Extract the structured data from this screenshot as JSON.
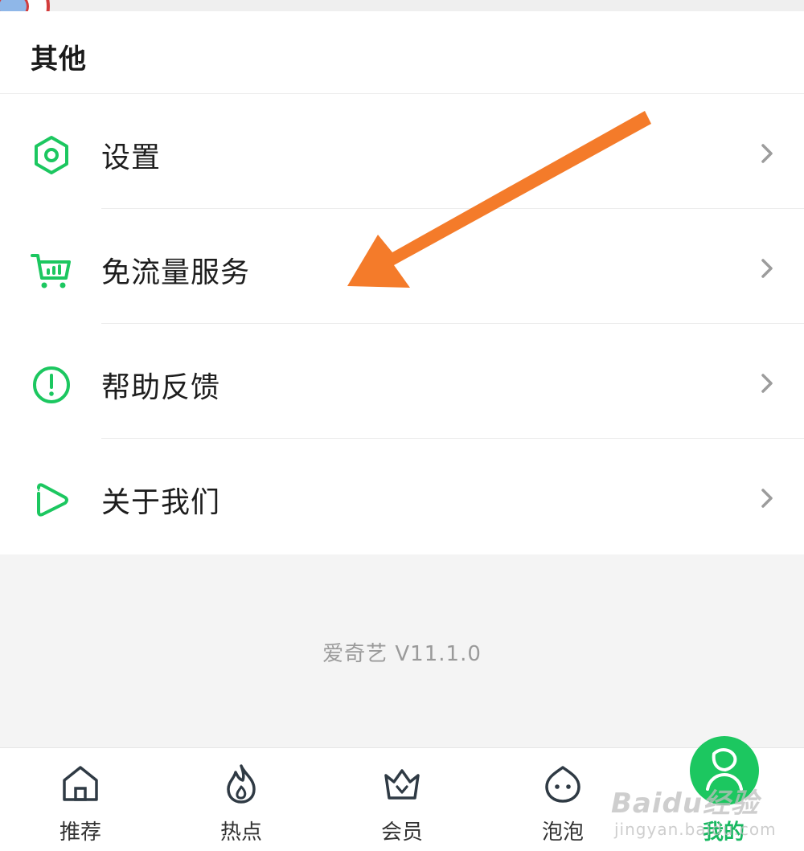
{
  "section": {
    "title": "其他"
  },
  "menu": [
    {
      "label": "设置",
      "icon": "settings-hexagon-icon"
    },
    {
      "label": "免流量服务",
      "icon": "cart-icon"
    },
    {
      "label": "帮助反馈",
      "icon": "help-exclamation-icon"
    },
    {
      "label": "关于我们",
      "icon": "play-about-icon"
    }
  ],
  "version": "爱奇艺 V11.1.0",
  "tabbar": [
    {
      "label": "推荐",
      "icon": "home-icon",
      "active": false
    },
    {
      "label": "热点",
      "icon": "flame-icon",
      "active": false
    },
    {
      "label": "会员",
      "icon": "crown-icon",
      "active": false
    },
    {
      "label": "泡泡",
      "icon": "bubble-face-icon",
      "active": false
    },
    {
      "label": "我的",
      "icon": "profile-icon",
      "active": true
    }
  ],
  "watermark": {
    "brand": "Baidu经验",
    "url": "jingyan.baidu.com"
  },
  "colors": {
    "accent": "#1cc760",
    "arrow": "#f47b2a",
    "text": "#1d1d1d",
    "muted": "#9a9a9a"
  }
}
